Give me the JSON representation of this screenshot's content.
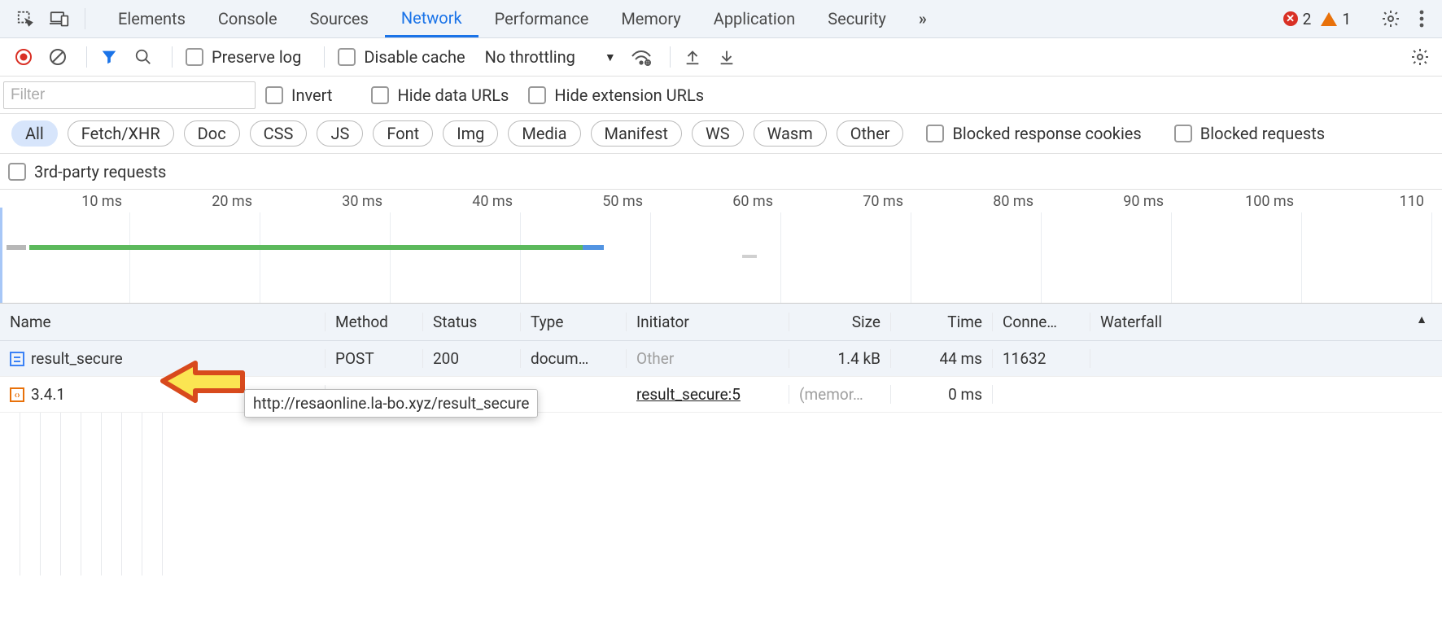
{
  "tabs": {
    "elements": "Elements",
    "console": "Console",
    "sources": "Sources",
    "network": "Network",
    "performance": "Performance",
    "memory": "Memory",
    "application": "Application",
    "security": "Security",
    "more_symbol": "»"
  },
  "issues": {
    "error_count": "2",
    "warning_count": "1"
  },
  "toolbar": {
    "preserve_log": "Preserve log",
    "disable_cache": "Disable cache",
    "throttling": "No throttling"
  },
  "filter": {
    "placeholder": "Filter",
    "invert": "Invert",
    "hide_data_urls": "Hide data URLs",
    "hide_ext_urls": "Hide extension URLs"
  },
  "pills": {
    "all": "All",
    "fetch_xhr": "Fetch/XHR",
    "doc": "Doc",
    "css": "CSS",
    "js": "JS",
    "font": "Font",
    "img": "Img",
    "media": "Media",
    "manifest": "Manifest",
    "ws": "WS",
    "wasm": "Wasm",
    "other": "Other",
    "blocked_cookies": "Blocked response cookies",
    "blocked_requests": "Blocked requests"
  },
  "third_party": "3rd-party requests",
  "timeline_ticks": [
    "10 ms",
    "20 ms",
    "30 ms",
    "40 ms",
    "50 ms",
    "60 ms",
    "70 ms",
    "80 ms",
    "90 ms",
    "100 ms",
    "110"
  ],
  "columns": {
    "name": "Name",
    "method": "Method",
    "status": "Status",
    "type": "Type",
    "initiator": "Initiator",
    "size": "Size",
    "time": "Time",
    "conn": "Conne…",
    "waterfall": "Waterfall"
  },
  "requests": [
    {
      "name": "result_secure",
      "method": "POST",
      "status": "200",
      "type": "docum…",
      "initiator": "Other",
      "initiator_muted": true,
      "size": "1.4 kB",
      "time": "44 ms",
      "conn": "11632",
      "icon": "doc",
      "wf": {
        "gray_l": 0,
        "gray_w": 8,
        "green_l": 8,
        "green_w": 175,
        "blue_l": 183,
        "blue_w": 10
      }
    },
    {
      "name": "3.4.1",
      "method": "",
      "status": "",
      "type": "",
      "initiator": "result_secure:5",
      "initiator_link": true,
      "size": "(memor…",
      "size_muted": true,
      "time": "0 ms",
      "conn": "",
      "icon": "script",
      "wf": {
        "tick_l": 211
      }
    }
  ],
  "tooltip": "http://resaonline.la-bo.xyz/result_secure"
}
